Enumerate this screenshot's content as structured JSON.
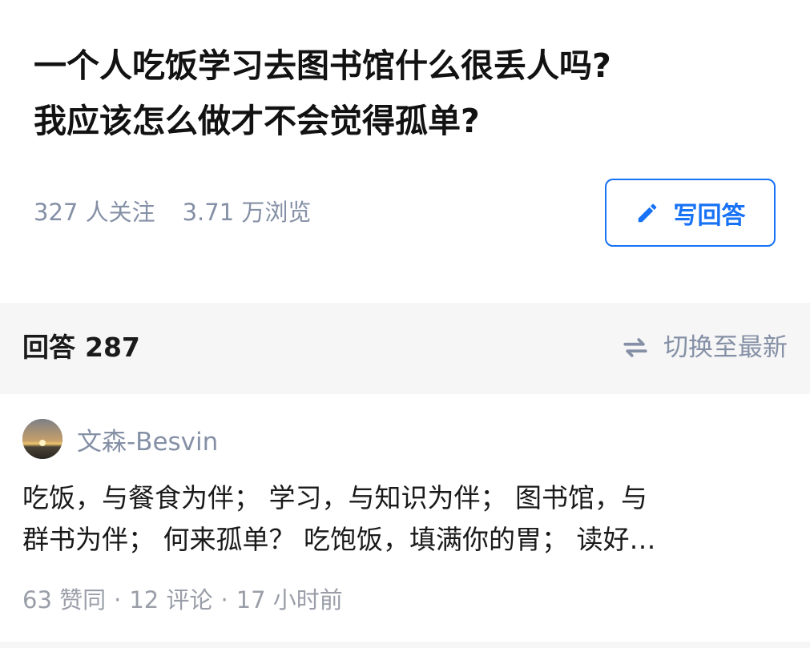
{
  "question": {
    "title_lines": [
      "一个人吃饭学习去图书馆什么很丢人吗?",
      "我应该怎么做才不会觉得孤单?"
    ],
    "followers": "327 人关注",
    "views": "3.71 万浏览",
    "write_answer_label": "写回答"
  },
  "answers_header": {
    "label": "回答",
    "count": "287",
    "switch_label": "切换至最新"
  },
  "answer": {
    "author": "文森-Besvin",
    "excerpt_lines": [
      "吃饭，与餐食为伴； 学习，与知识为伴； 图书馆，与",
      "群书为伴； 何来孤单？ 吃饱饭，填满你的胃； 读好…"
    ],
    "upvotes": "63 赞同",
    "comments": "12 评论",
    "time": "17 小时前",
    "separator": "·"
  },
  "colors": {
    "accent": "#1772f6",
    "muted_text": "#8590a6",
    "section_bg": "#f6f6f6"
  },
  "icons": {
    "write_answer": "pencil-icon",
    "switch_sort": "swap-arrows-icon"
  }
}
